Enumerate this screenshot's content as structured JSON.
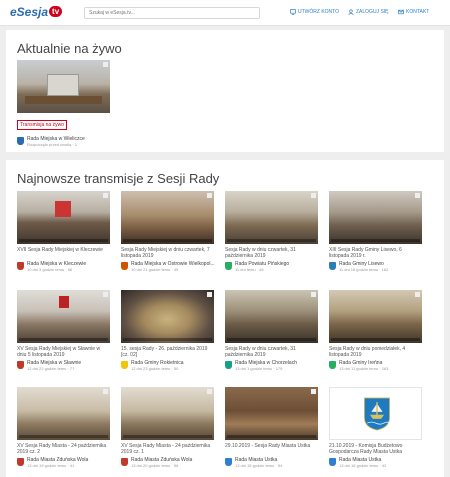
{
  "header": {
    "logo_text": "eSesja",
    "logo_badge": "tv",
    "search_placeholder": "Szukaj w eSesja.tv...",
    "nav": [
      {
        "label": "UTWÓRZ KONTO",
        "icon": "monitor-icon"
      },
      {
        "label": "ZALOGUJ SIĘ",
        "icon": "user-icon"
      },
      {
        "label": "KONTAKT",
        "icon": "envelope-icon"
      }
    ],
    "accent_color": "#2f80d0"
  },
  "live": {
    "title": "Aktualnie na żywo",
    "item": {
      "badge": "Transmisja na żywo",
      "channel": "Rada Miejska w Wieliczce",
      "meta": "Rozpoczęło przed chwilą  ·  1"
    }
  },
  "recent": {
    "title": "Najnowsze transmisje z Sesji Rady",
    "cards": [
      {
        "title": "XVII Sesja Rady Miejskiej w Kleczewie",
        "channel": "Rada Miejska w Kleczewie",
        "meta": "10 dni 3 godzin temu  ·  66"
      },
      {
        "title": "Sesja Rady Miejskiej w dniu czwartek, 7 listopada 2019",
        "channel": "Rada Miejska w Ostrowie Wielkopol...",
        "meta": "10 dni 21 godzin temu  ·  45"
      },
      {
        "title": "Sesja Rady w dniu czwartek, 31 października 2019",
        "channel": "Rada Powiatu Pińskiego",
        "meta": "11 dni temu  ·  46"
      },
      {
        "title": "XIII Sesja Rady Gminy Lisewo, 6 listopada 2019 r.",
        "channel": "Rada Gminy Lisewo",
        "meta": "11 dni 16 godzin temu  ·  162"
      },
      {
        "title": "XV Sesja Rady Miejskiej w Sławnie w dniu 5 listopada 2019",
        "channel": "Rada Miejska w Sławnie",
        "meta": "12 dni 22 godzin temu  ·  77"
      },
      {
        "title": "15. sesja Rady - 26. października 2019 [cz. 02]",
        "channel": "Rada Gminy Rokietnica",
        "meta": "12 dni 23 godzin temu  ·  50"
      },
      {
        "title": "Sesja Rady w dniu czwartek, 31 października 2019",
        "channel": "Rada Miejska w Chorzelach",
        "meta": "13 dni 1 godzin temu  ·  179"
      },
      {
        "title": "Sesja Rady w dniu poniedziałek, 4 listopada 2019",
        "channel": "Rada Gminy Ireńna",
        "meta": "13 dni 11 godzin temu  ·  263"
      },
      {
        "title": "XV Sesja Rady Miasta - 24 października 2019 cz. 2",
        "channel": "Rada Miasta Zduńska Wola",
        "meta": "13 dni 19 godzin temu  ·  41"
      },
      {
        "title": "XV Sesja Rady Miasta - 24 października 2019 cz. 1",
        "channel": "Rada Miasta Zduńska Wola",
        "meta": "13 dni 20 godzin temu  ·  56"
      },
      {
        "title": "29.10.2019 - Sesja Rady Miasta Ustka",
        "channel": "Rada Miasta Ustka",
        "meta": "13 dni 15 godzin temu  ·  54"
      },
      {
        "title": "21.10.2019 - Komisja Budżetowo Gospodarcza Rady Miasta Ustka",
        "channel": "Rada Miasta Ustka",
        "meta": "13 dni 16 godzin temu  ·  42"
      }
    ]
  }
}
